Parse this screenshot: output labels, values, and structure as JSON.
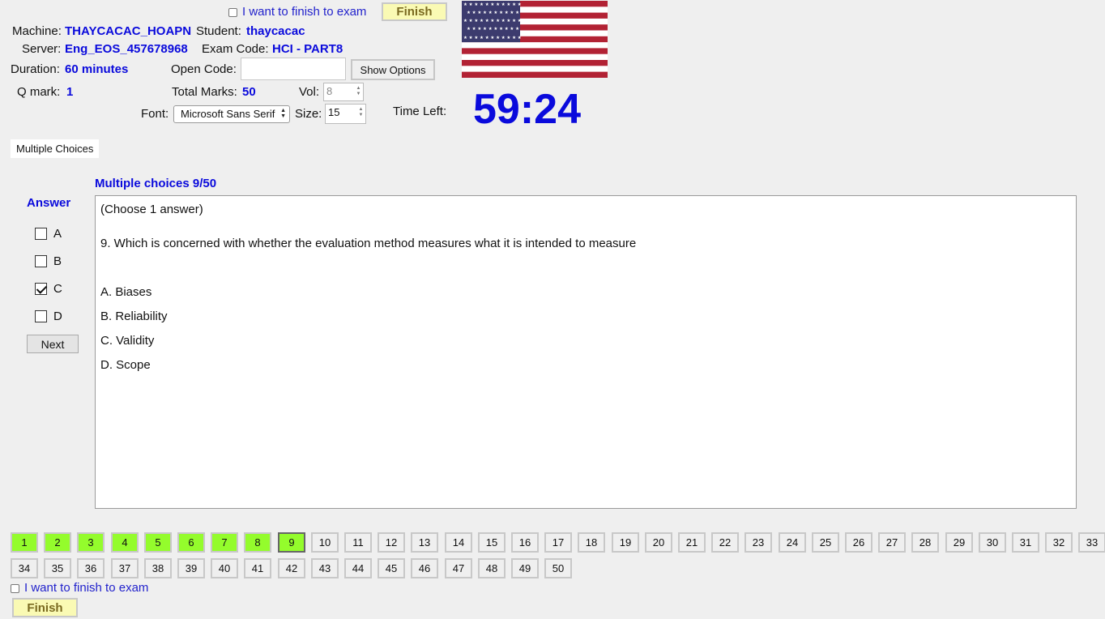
{
  "header": {
    "finish_checkbox_label": "I want to finish to exam",
    "finish_button": "Finish",
    "machine_label": "Machine:",
    "machine_value": "THAYCACAC_HOAPN",
    "student_label": "Student:",
    "student_value": "thaycacac",
    "server_label": "Server:",
    "server_value": "Eng_EOS_457678968",
    "exam_code_label": "Exam Code:",
    "exam_code_value": "HCI - PART8",
    "duration_label": "Duration:",
    "duration_value": "60 minutes",
    "open_code_label": "Open Code:",
    "open_code_value": "",
    "show_options_button": "Show Options",
    "qmark_label": "Q mark:",
    "qmark_value": "1",
    "total_marks_label": "Total Marks:",
    "total_marks_value": "50",
    "vol_label": "Vol:",
    "vol_value": "8",
    "font_label": "Font:",
    "font_value": "Microsoft Sans Serif",
    "size_label": "Size:",
    "size_value": "15",
    "time_left_label": "Time Left:",
    "time_left_value": "59:24",
    "flag_icon": "us-flag-icon"
  },
  "tab": {
    "label": "Multiple Choices"
  },
  "question": {
    "heading": "Multiple choices 9/50",
    "instruction": "(Choose 1 answer)",
    "text": "9. Which is concerned with whether the evaluation method measures what it is intended to measure",
    "options": [
      {
        "text": "A. Biases"
      },
      {
        "text": "B. Reliability"
      },
      {
        "text": "C. Validity"
      },
      {
        "text": "D. Scope"
      }
    ]
  },
  "answer_panel": {
    "title": "Answer",
    "choices": [
      {
        "label": "A",
        "checked": false
      },
      {
        "label": "B",
        "checked": false
      },
      {
        "label": "C",
        "checked": true
      },
      {
        "label": "D",
        "checked": false
      }
    ],
    "next_button": "Next"
  },
  "navigator": {
    "current": 9,
    "answered": [
      1,
      2,
      3,
      4,
      5,
      6,
      7,
      8,
      9
    ],
    "row1": [
      "1",
      "2",
      "3",
      "4",
      "5",
      "6",
      "7",
      "8",
      "9",
      "10",
      "11",
      "12",
      "13",
      "14",
      "15",
      "16",
      "17",
      "18",
      "19",
      "20",
      "21",
      "22",
      "23",
      "24",
      "25",
      "26",
      "27",
      "28",
      "29",
      "30",
      "31",
      "32",
      "33"
    ],
    "row2": [
      "34",
      "35",
      "36",
      "37",
      "38",
      "39",
      "40",
      "41",
      "42",
      "43",
      "44",
      "45",
      "46",
      "47",
      "48",
      "49",
      "50"
    ]
  },
  "footer": {
    "finish_checkbox_label": "I want to finish to exam",
    "finish_button": "Finish"
  },
  "colors": {
    "accent_blue": "#0a0adc",
    "answered_green": "#94fc2c",
    "finish_yellow": "#fafab4"
  }
}
